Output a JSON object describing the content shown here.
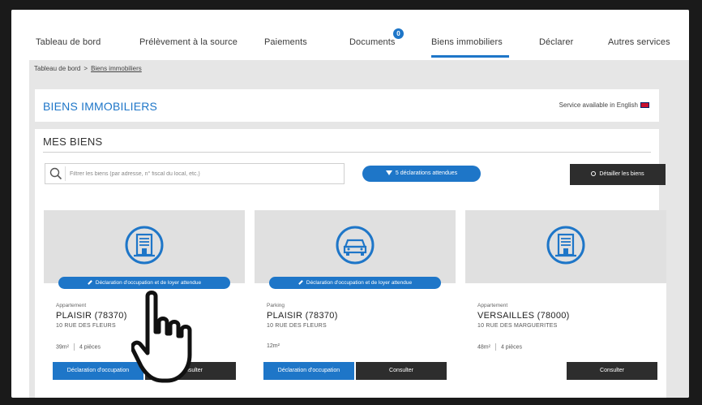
{
  "nav": {
    "items": [
      {
        "label": "Tableau de bord"
      },
      {
        "label": "Prélèvement à la source"
      },
      {
        "label": "Paiements"
      },
      {
        "label": "Documents",
        "badge": "0"
      },
      {
        "label": "Biens immobiliers",
        "active": true
      },
      {
        "label": "Déclarer"
      },
      {
        "label": "Autres services"
      }
    ]
  },
  "breadcrumb": {
    "home": "Tableau de bord",
    "separator": ">",
    "current": "Biens immobiliers"
  },
  "header": {
    "title": "BIENS IMMOBILIERS",
    "english": "Service available in English"
  },
  "main": {
    "section_title": "MES BIENS",
    "search_placeholder": "Filtrer les biens (par adresse, n° fiscal du local, etc.)",
    "filter_pill": "5 déclarations attendues",
    "detail_button": "Détailler les biens"
  },
  "cards": [
    {
      "icon": "building-icon",
      "tag": "Déclaration d'occupation et de loyer attendue",
      "type": "Appartement",
      "city": "PLAISIR  (78370)",
      "street": "10 RUE DES FLEURS",
      "area": "39m²",
      "rooms": "4 pièces",
      "declare_button": "Déclaration d'occupation",
      "consult_button": "Consulter"
    },
    {
      "icon": "car-icon",
      "tag": "Déclaration d'occupation et de loyer attendue",
      "type": "Parking",
      "city": "PLAISIR  (78370)",
      "street": "10 RUE DES FLEURS",
      "area": "12m²",
      "rooms": "",
      "declare_button": "Déclaration d'occupation",
      "consult_button": "Consulter"
    },
    {
      "icon": "building-icon",
      "tag": "",
      "type": "Appartement",
      "city": "VERSAILLES  (78000)",
      "street": "10 RUE DES MARGUERITES",
      "area": "48m²",
      "rooms": "4 pièces",
      "declare_button": "",
      "consult_button": "Consulter"
    }
  ],
  "colors": {
    "accent": "#1e76c8",
    "dark_button": "#2d2d2d",
    "band": "#e6e6e6"
  }
}
